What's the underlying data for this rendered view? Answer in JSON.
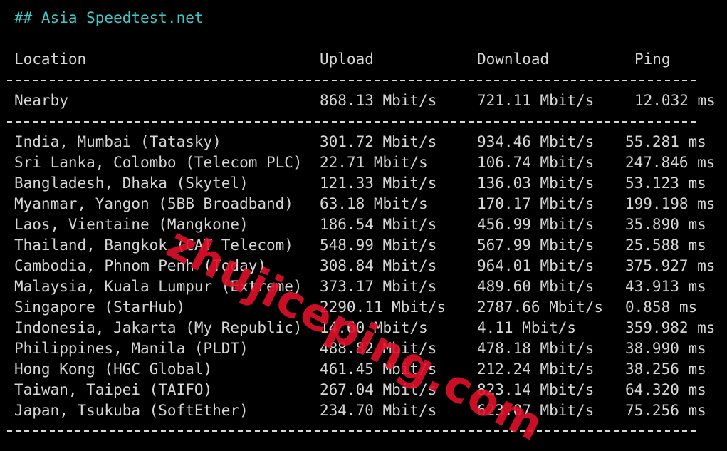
{
  "title": "## Asia Speedtest.net",
  "headers": {
    "location": "Location",
    "upload": "Upload",
    "download": "Download",
    "ping": "Ping"
  },
  "nearby": {
    "location": "Nearby",
    "upload": "868.13 Mbit/s",
    "download": "721.11 Mbit/s",
    "ping": "12.032 ms"
  },
  "rows": [
    {
      "location": "India, Mumbai (Tatasky)",
      "upload": "301.72 Mbit/s",
      "download": "934.46 Mbit/s",
      "ping": "55.281 ms"
    },
    {
      "location": "Sri Lanka, Colombo (Telecom PLC)",
      "upload": "22.71 Mbit/s",
      "download": "106.74 Mbit/s",
      "ping": "247.846 ms"
    },
    {
      "location": "Bangladesh, Dhaka (Skytel)",
      "upload": "121.33 Mbit/s",
      "download": "136.03 Mbit/s",
      "ping": "53.123 ms"
    },
    {
      "location": "Myanmar, Yangon (5BB Broadband)",
      "upload": "63.18 Mbit/s",
      "download": "170.17 Mbit/s",
      "ping": "199.198 ms"
    },
    {
      "location": "Laos, Vientaine (Mangkone)",
      "upload": "186.54 Mbit/s",
      "download": "456.99 Mbit/s",
      "ping": "35.890 ms"
    },
    {
      "location": "Thailand, Bangkok (CAT Telecom)",
      "upload": "548.99 Mbit/s",
      "download": "567.99 Mbit/s",
      "ping": "25.588 ms"
    },
    {
      "location": "Cambodia, Phnom Penh (Today)",
      "upload": "308.84 Mbit/s",
      "download": "964.01 Mbit/s",
      "ping": "375.927 ms"
    },
    {
      "location": "Malaysia, Kuala Lumpur (Extreme)",
      "upload": "373.17 Mbit/s",
      "download": "489.60 Mbit/s",
      "ping": "43.913 ms"
    },
    {
      "location": "Singapore (StarHub)",
      "upload": "2290.11 Mbit/s",
      "download": "2787.66 Mbit/s",
      "ping": "0.858 ms"
    },
    {
      "location": "Indonesia, Jakarta (My Republic)",
      "upload": "14.60 Mbit/s",
      "download": "4.11 Mbit/s",
      "ping": "359.982 ms"
    },
    {
      "location": "Philippines, Manila (PLDT)",
      "upload": "488.82 Mbit/s",
      "download": "478.18 Mbit/s",
      "ping": "38.990 ms"
    },
    {
      "location": "Hong Kong (HGC Global)",
      "upload": "461.45 Mbit/s",
      "download": "212.24 Mbit/s",
      "ping": "38.256 ms"
    },
    {
      "location": "Taiwan, Taipei (TAIFO)",
      "upload": "267.04 Mbit/s",
      "download": "823.14 Mbit/s",
      "ping": "64.320 ms"
    },
    {
      "location": "Japan, Tsukuba (SoftEther)",
      "upload": "234.70 Mbit/s",
      "download": "623.07 Mbit/s",
      "ping": "75.256 ms"
    }
  ],
  "watermark": "zhujiceping.com",
  "colors": {
    "background": "#000000",
    "text": "#d6d6d6",
    "title": "#3ec9c9",
    "watermark": "#e0102b"
  }
}
